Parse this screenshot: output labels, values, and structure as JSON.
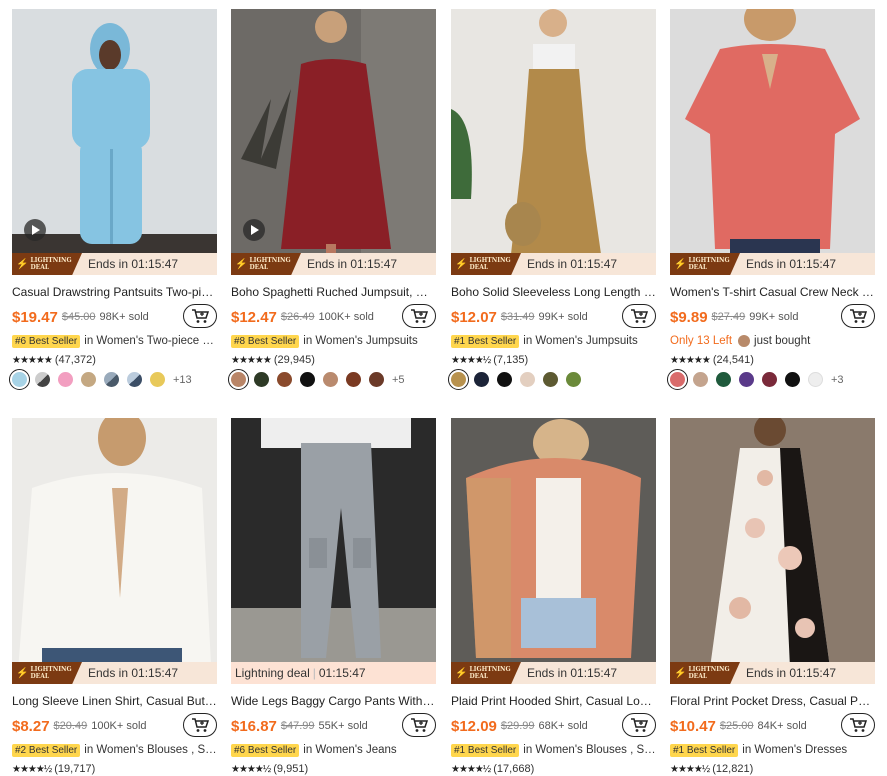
{
  "products": [
    {
      "title": "Casual Drawstring Pantsuits Two-piec…",
      "price": "$19.47",
      "orig": "$45.00",
      "sold": "98K+ sold",
      "deal_label": "Ends in 01:15:47",
      "best": "#6 Best Seller",
      "category": "in Women's Two-piece …",
      "stars": "★★★★★",
      "rating": "(47,372)",
      "more": "+13",
      "has_video": true,
      "colors": [
        "#a7d3e6",
        "#555",
        "#f29ec0",
        "#c4a882",
        "#4a5a6a",
        "#3b4e66",
        "#e8c95a"
      ]
    },
    {
      "title": "Boho Spaghetti Ruched Jumpsuit, Ca…",
      "price": "$12.47",
      "orig": "$26.49",
      "sold": "100K+ sold",
      "deal_label": "Ends in 01:15:47",
      "best": "#8 Best Seller",
      "category": "in Women's Jumpsuits",
      "stars": "★★★★★",
      "rating": "(29,945)",
      "more": "+5",
      "has_video": true,
      "colors": [
        "#b98567",
        "#2e3a26",
        "#8a4a2c",
        "#111",
        "#b98a6e",
        "#7a3a22",
        "#6b3a28"
      ]
    },
    {
      "title": "Boho Solid Sleeveless Long Length Ju…",
      "price": "$12.07",
      "orig": "$31.49",
      "sold": "99K+ sold",
      "deal_label": "Ends in 01:15:47",
      "best": "#1 Best Seller",
      "category": "in Women's Jumpsuits",
      "stars": "★★★★½",
      "rating": "(7,135)",
      "more": "",
      "has_video": false,
      "colors": [
        "#b8924e",
        "#1c2438",
        "#111",
        "#e3cfc0",
        "#5d5a32",
        "#6b8a3a"
      ]
    },
    {
      "title": "Women's T-shirt Casual Crew Neck S…",
      "price": "$9.89",
      "orig": "$27.49",
      "sold": "99K+ sold",
      "deal_label": "Ends in 01:15:47",
      "best": "",
      "category": "",
      "low_stock": "Only 13 Left",
      "bought": "just bought",
      "stars": "★★★★★",
      "rating": "(24,541)",
      "more": "+3",
      "has_video": false,
      "colors": [
        "#d96b6b",
        "#c4a48e",
        "#1f5a3c",
        "#5a3a8a",
        "#7a2a3a",
        "#111",
        "#eeeeee"
      ]
    },
    {
      "title": "Long Sleeve Linen Shirt, Casual Butto…",
      "price": "$8.27",
      "orig": "$20.49",
      "sold": "100K+ sold",
      "deal_label": "Ends in 01:15:47",
      "best": "#2 Best Seller",
      "category": "in Women's Blouses , S…",
      "stars": "★★★★½",
      "rating": "(19,717)",
      "has_video": false
    },
    {
      "title": "Wide Legs Baggy Cargo Pants With Fl…",
      "price": "$16.87",
      "orig": "$47.99",
      "sold": "55K+ sold",
      "deal_plain_name": "Lightning deal",
      "deal_plain_time": "01:15:47",
      "best": "#6 Best Seller",
      "category": "in Women's Jeans",
      "stars": "★★★★½",
      "rating": "(9,951)",
      "has_video": false
    },
    {
      "title": "Plaid Print Hooded Shirt, Casual Long…",
      "price": "$12.09",
      "orig": "$29.99",
      "sold": "68K+ sold",
      "deal_label": "Ends in 01:15:47",
      "best": "#1 Best Seller",
      "category": "in Women's Blouses , S…",
      "stars": "★★★★½",
      "rating": "(17,668)",
      "has_video": false
    },
    {
      "title": "Floral Print Pocket Dress, Casual Poc…",
      "price": "$10.47",
      "orig": "$25.00",
      "sold": "84K+ sold",
      "deal_label": "Ends in 01:15:47",
      "best": "#1 Best Seller",
      "category": "in Women's Dresses",
      "stars": "★★★★½",
      "rating": "(12,821)",
      "has_video": false
    }
  ],
  "deal_badge": {
    "line1": "Lightning",
    "line2": "Deal"
  }
}
